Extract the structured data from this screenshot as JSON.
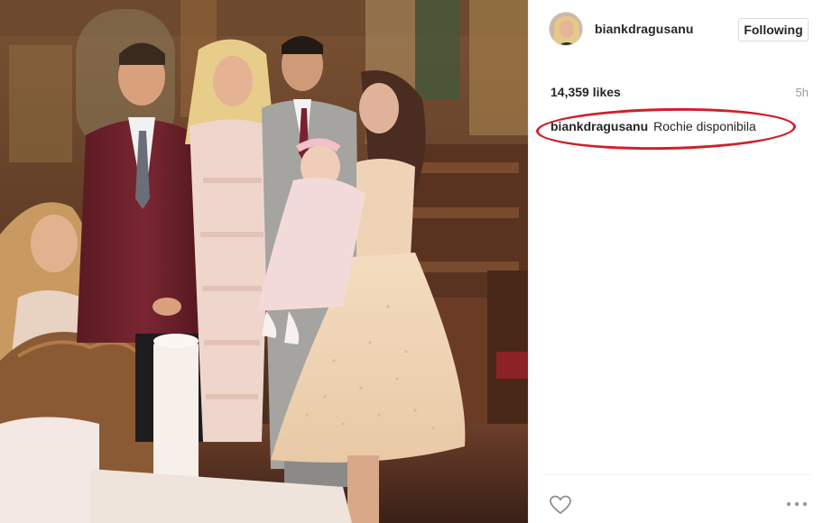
{
  "post": {
    "image_alt": "Family photo at a church christening ceremony",
    "author": {
      "username": "biankdragusanu"
    },
    "follow_label": "Following",
    "likes_text": "14,359 likes",
    "time_ago": "5h",
    "caption": {
      "username": "biankdragusanu",
      "text": "Rochie disponibila"
    }
  },
  "icons": {
    "like": "heart-icon",
    "more": "more-options-icon"
  },
  "colors": {
    "annotation_circle": "#d0202a",
    "text_primary": "#262626",
    "text_muted": "#999999",
    "border": "#dbdbdb"
  }
}
